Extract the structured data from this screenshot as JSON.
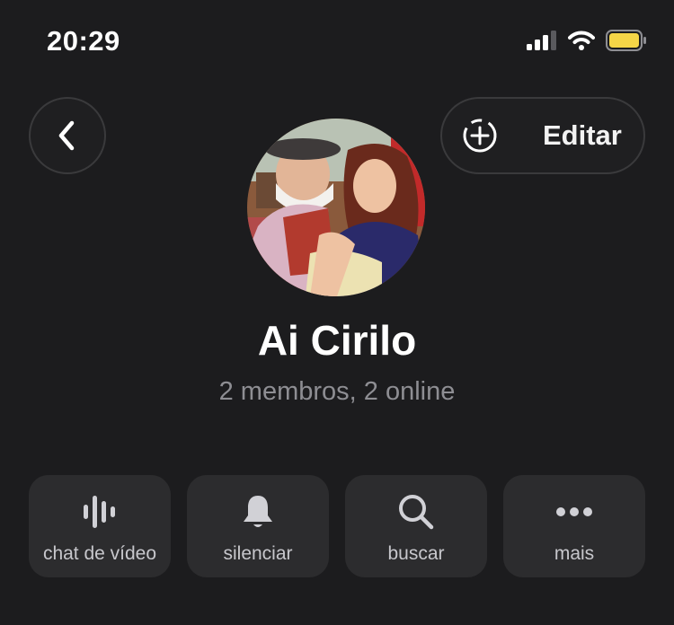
{
  "status_bar": {
    "time": "20:29",
    "battery_color": "#f5d547"
  },
  "header": {
    "back_icon": "chevron-left-icon",
    "edit_icon": "add-circle-dashed-icon",
    "edit_label": "Editar"
  },
  "profile": {
    "name": "Ai Cirilo",
    "subtitle": "2 membros, 2 online"
  },
  "actions": [
    {
      "label": "chat de vídeo",
      "icon": "voice-wave-icon"
    },
    {
      "label": "silenciar",
      "icon": "bell-icon"
    },
    {
      "label": "buscar",
      "icon": "search-icon"
    },
    {
      "label": "mais",
      "icon": "more-dots-icon"
    }
  ]
}
